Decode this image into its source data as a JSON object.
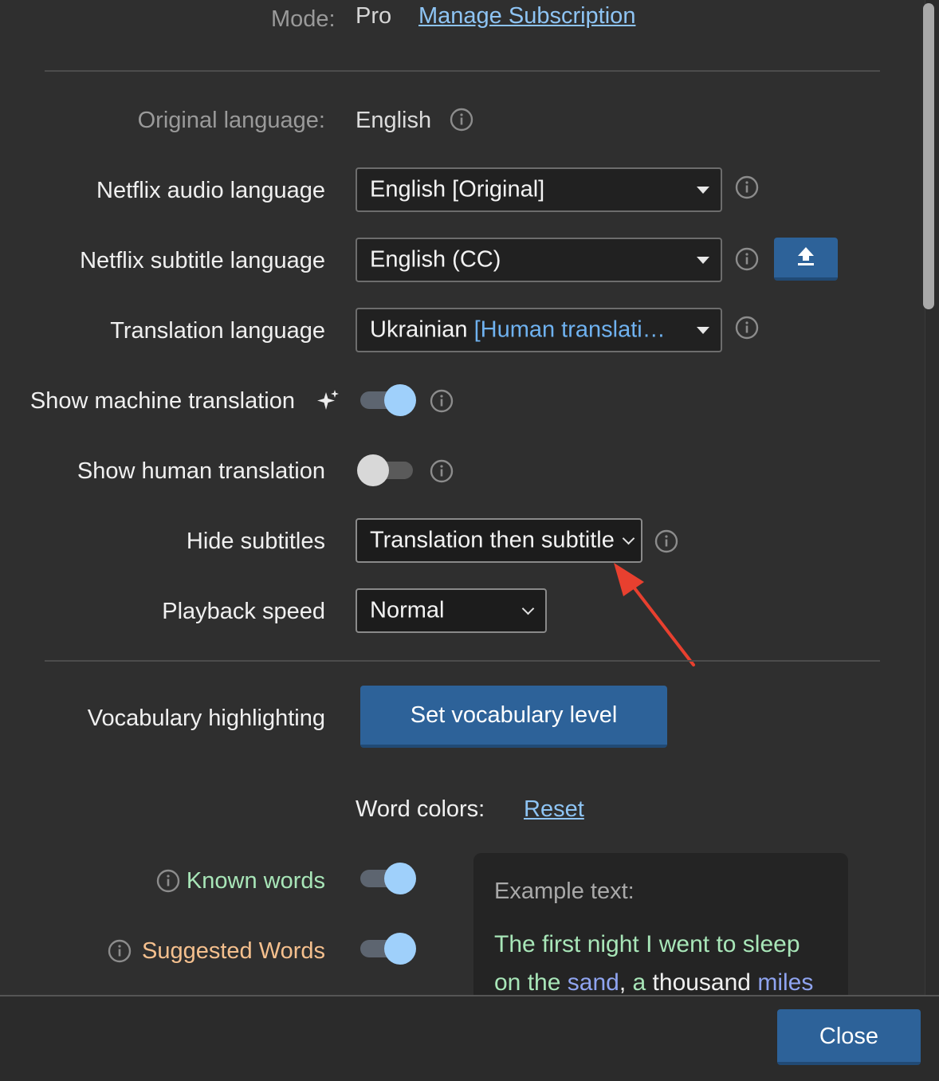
{
  "mode": {
    "label": "Mode:",
    "value": "Pro",
    "manage_link": "Manage Subscription"
  },
  "original_language": {
    "label": "Original language:",
    "value": "English"
  },
  "audio_language": {
    "label": "Netflix audio language",
    "selected": "English [Original]"
  },
  "subtitle_language": {
    "label": "Netflix subtitle language",
    "selected": "English (CC)",
    "upload_icon": "upload-icon"
  },
  "translation_language": {
    "label": "Translation language",
    "selected_main": "Ukrainian",
    "selected_note": "[Human translati…"
  },
  "machine_translation": {
    "label": "Show machine translation",
    "icon": "sparkle-icon",
    "enabled": true
  },
  "human_translation": {
    "label": "Show human translation",
    "enabled": false
  },
  "hide_subtitles": {
    "label": "Hide subtitles",
    "selected": "Translation then subtitle"
  },
  "playback_speed": {
    "label": "Playback speed",
    "selected": "Normal"
  },
  "vocabulary": {
    "label": "Vocabulary highlighting",
    "button": "Set vocabulary level"
  },
  "word_colors": {
    "label": "Word colors:",
    "reset": "Reset"
  },
  "known_words": {
    "label": "Known words",
    "enabled": true
  },
  "suggested_words": {
    "label": "Suggested Words",
    "enabled": true
  },
  "example": {
    "title": "Example text:",
    "line1": "The first night I went to sleep",
    "line2": {
      "w1": "on the",
      "w2": "sand",
      "w3": ",",
      "w4": "a",
      "w5": "thousand",
      "w6": "miles"
    }
  },
  "footer": {
    "close": "Close"
  },
  "colors": {
    "background": "#2f2f2f",
    "accent_button": "#2d6299",
    "link": "#8ec4f4",
    "known_green": "#a8e6b8",
    "suggested_orange": "#f5c08e",
    "annotation_arrow": "#e8402f"
  }
}
